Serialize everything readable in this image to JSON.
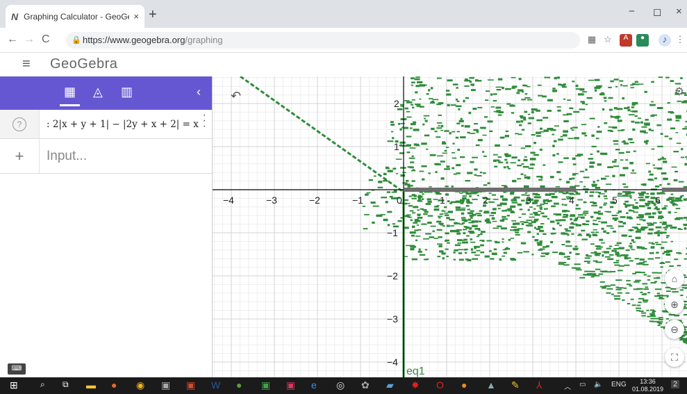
{
  "browser": {
    "tab_title": "Graphing Calculator - GeoGebra",
    "tab_icon": "N",
    "close_tab": "×",
    "new_tab": "+",
    "url_host": "https://www.geogebra.org",
    "url_path": "/graphing",
    "win_min": "−",
    "win_max": "◻",
    "win_close": "×"
  },
  "app": {
    "logo": "GeoGebra"
  },
  "algebra": {
    "equation": ": 2|x + y + 1| − |2y + x + 2| = x",
    "input_placeholder": "Input...",
    "help_symbol": "?",
    "plus_symbol": "+"
  },
  "graph": {
    "x_ticks": [
      "−4",
      "−3",
      "−2",
      "−1",
      "0",
      "1",
      "2",
      "3",
      "4",
      "5",
      "6"
    ],
    "y_ticks": [
      "2",
      "1",
      "−1",
      "−2",
      "−3",
      "−4"
    ],
    "curve_label": "eq1",
    "curve_color": "#2f8c3a",
    "axis_highlight_color": "#6e6e6e",
    "grid": true
  },
  "taskbar": {
    "lang": "ENG",
    "time": "13:36",
    "date": "01.08.2019",
    "notif": "2"
  }
}
